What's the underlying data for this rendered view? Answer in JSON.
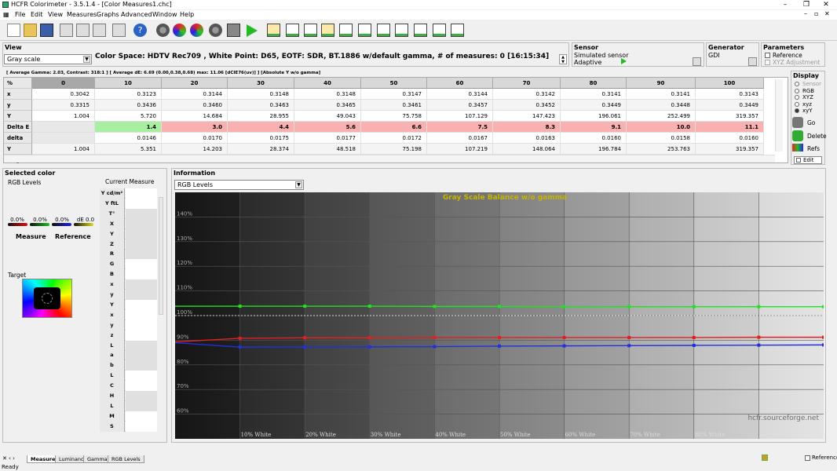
{
  "window": {
    "title": "HCFR Colorimeter - 3.5.1.4 - [Color Measures1.chc]",
    "min": "–",
    "max": "❐",
    "close": "✕"
  },
  "menu": [
    "File",
    "Edit",
    "View",
    "Measures",
    "Graphs",
    "Advanced",
    "Window",
    "Help"
  ],
  "menu_controls": [
    "–",
    "▫",
    "✕"
  ],
  "view": {
    "header": "View",
    "mode_select": "Gray scale",
    "info": "Color Space: HDTV Rec709 , White Point: D65, EOTF:  SDR, BT.1886 w/default gamma, # of measures: 0 [16:15:34]"
  },
  "sensor": {
    "header": "Sensor",
    "name": "Simulated sensor",
    "mode": "Adaptive"
  },
  "generator": {
    "header": "Generator",
    "name": "GDI"
  },
  "parameters": {
    "header": "Parameters",
    "reference": "Reference",
    "xyz_adjust": "XYZ Adjustment"
  },
  "summary": "[ Average Gamma: 2.03, Contrast: 318:1 ] [ Average dE: 6.69 (0.00,0.38,0.68) max: 11.06 [dCIE76(uv)] ] [Absolute Y w/o gamma]",
  "table": {
    "corner": "% White",
    "columns": [
      "0",
      "10",
      "20",
      "30",
      "40",
      "50",
      "60",
      "70",
      "80",
      "90",
      "100"
    ],
    "rows": [
      {
        "label": "x",
        "values": [
          "0.3042",
          "0.3123",
          "0.3144",
          "0.3148",
          "0.3148",
          "0.3147",
          "0.3144",
          "0.3142",
          "0.3141",
          "0.3141",
          "0.3143"
        ]
      },
      {
        "label": "y",
        "values": [
          "0.3315",
          "0.3436",
          "0.3460",
          "0.3463",
          "0.3465",
          "0.3461",
          "0.3457",
          "0.3452",
          "0.3449",
          "0.3448",
          "0.3449"
        ]
      },
      {
        "label": "Y",
        "values": [
          "1.004",
          "5.720",
          "14.684",
          "28.955",
          "49.043",
          "75.758",
          "107.129",
          "147.423",
          "196.061",
          "252.499",
          "319.357"
        ]
      },
      {
        "label": "Delta E",
        "values": [
          "",
          "1.4",
          "3.0",
          "4.4",
          "5.6",
          "6.6",
          "7.5",
          "8.3",
          "9.1",
          "10.0",
          "11.1"
        ]
      },
      {
        "label": "delta xy",
        "values": [
          "",
          "0.0146",
          "0.0170",
          "0.0175",
          "0.0177",
          "0.0172",
          "0.0167",
          "0.0163",
          "0.0160",
          "0.0158",
          "0.0160"
        ]
      },
      {
        "label": "Y target",
        "values": [
          "1.004",
          "5.351",
          "14.203",
          "28.374",
          "48.518",
          "75.198",
          "107.219",
          "148.064",
          "196.784",
          "253.763",
          "319.357"
        ]
      }
    ],
    "colors": {
      "green": "#a8f0a0",
      "red": "#f8b0b0"
    }
  },
  "display": {
    "header": "Display",
    "options": [
      "Sensor",
      "RGB",
      "XYZ",
      "xyz",
      "xyY"
    ],
    "selected": "xyY",
    "go": "Go",
    "delete": "Delete",
    "refs": "Refs",
    "edit": "Edit"
  },
  "selected_color": {
    "header": "Selected color",
    "rgb_levels": "RGB Levels",
    "current_measure": "Current Measure",
    "pcts": [
      "0.0%",
      "0.0%",
      "0.0%",
      "dE 0.0"
    ],
    "measure": "Measure",
    "reference": "Reference",
    "target": "Target",
    "grid_labels": [
      "Y cd/m²",
      "Y ftL",
      "T°",
      "X",
      "Y",
      "Z",
      "R",
      "G",
      "B",
      "x",
      "y",
      "Y",
      "x",
      "y",
      "z",
      "L",
      "a",
      "b",
      "L",
      "C",
      "H",
      "L",
      "M",
      "S"
    ]
  },
  "information": {
    "header": "Information",
    "select": "RGB Levels"
  },
  "chart_data": {
    "type": "line",
    "title": "Gray Scale Balance w/o gamma",
    "watermark": "hcfr.sourceforge.net",
    "x": [
      0,
      10,
      20,
      30,
      40,
      50,
      60,
      70,
      80,
      90,
      100
    ],
    "xlim": [
      0,
      100
    ],
    "ylim": [
      50,
      150
    ],
    "y_ticks": [
      60,
      70,
      80,
      90,
      100,
      110,
      120,
      130,
      140
    ],
    "y_tick_labels": [
      "60%",
      "70%",
      "80%",
      "90%",
      "100%",
      "110%",
      "120%",
      "130%",
      "140%"
    ],
    "x_tick_labels": [
      "10% White",
      "20% White",
      "30% White",
      "40% White",
      "50% White",
      "60% White",
      "70% White",
      "80% White",
      "90% White"
    ],
    "reference": 100,
    "series": [
      {
        "color": "#22e022",
        "values": [
          103.8,
          103.8,
          103.8,
          103.8,
          103.7,
          103.7,
          103.6,
          103.6,
          103.6,
          103.6,
          103.6
        ]
      },
      {
        "color": "#e02020",
        "values": [
          89.3,
          90.8,
          91.0,
          91.0,
          91.1,
          91.1,
          91.1,
          91.1,
          91.1,
          91.2,
          91.2
        ]
      },
      {
        "color": "#2030e0",
        "values": [
          89.0,
          87.2,
          87.2,
          87.3,
          87.4,
          87.6,
          87.7,
          87.8,
          87.9,
          88.0,
          88.1
        ]
      }
    ]
  },
  "tabs": [
    "Measures",
    "Luminance",
    "Gamma",
    "RGB Levels"
  ],
  "active_tab": "Measures",
  "status": {
    "ready": "Ready",
    "reference": "Reference"
  }
}
